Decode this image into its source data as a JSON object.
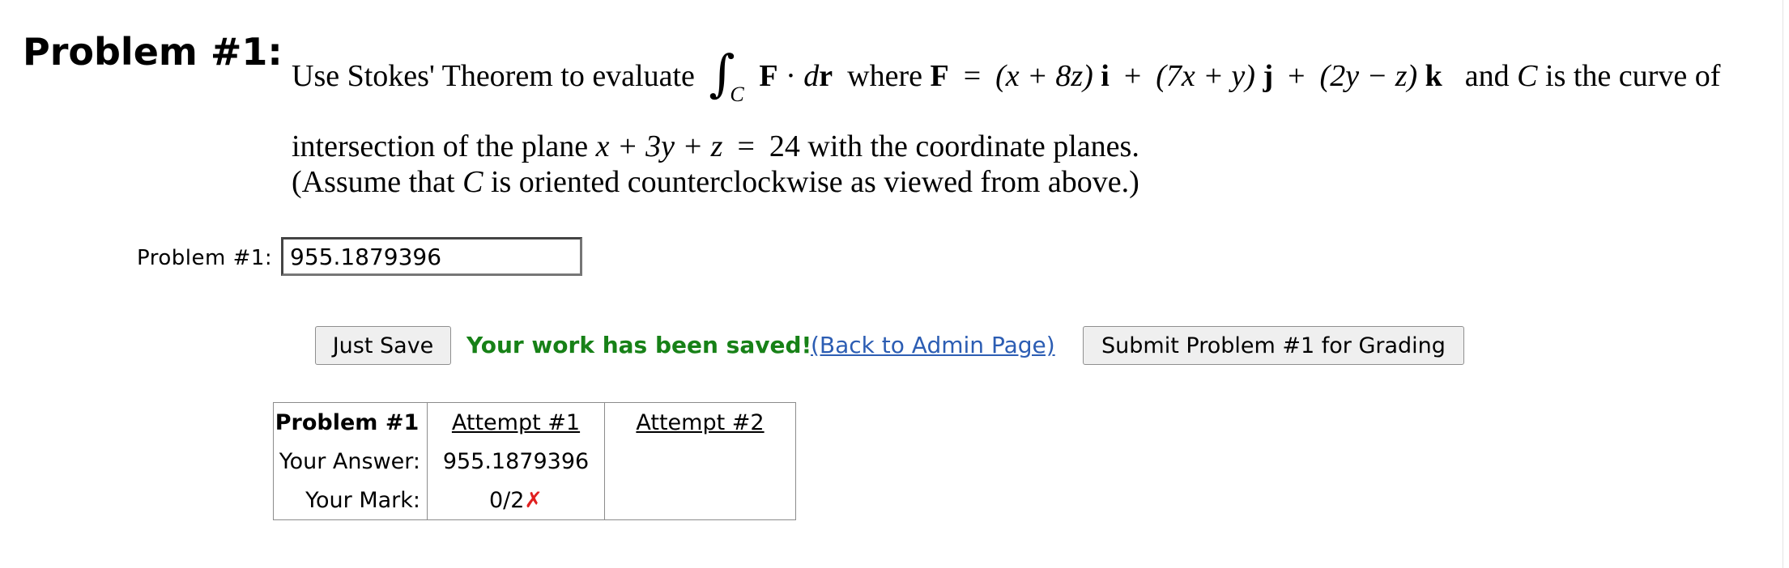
{
  "problem": {
    "heading": "Problem #1:",
    "statement": {
      "lead": "Use Stokes' Theorem to evaluate",
      "integral_sign": "∫",
      "integral_sub": "C",
      "integrand_F": "F",
      "integrand_dot": "·",
      "integrand_d": "d",
      "integrand_r": "r",
      "where": "where",
      "F": "F",
      "eq": "=",
      "comp_i_paren": "(x + 8z)",
      "i": "i",
      "plus1": "+",
      "comp_j_paren": "(7x + y)",
      "j": "j",
      "plus2": "+",
      "comp_k_paren": "(2y − z)",
      "k": "k",
      "and_text": "and",
      "C": "C",
      "tail": "is the curve of",
      "line2_lead": "intersection of the plane",
      "plane_eq": "x + 3y + z",
      "plane_eq_sign": "=",
      "plane_rhs": "24",
      "line2_tail": "with the coordinate planes.",
      "line3_lead": "(Assume that",
      "line3_C": "C",
      "line3_tail": "is oriented counterclockwise as viewed from above.)"
    }
  },
  "answer": {
    "label": "Problem #1:",
    "value": "955.1879396"
  },
  "actions": {
    "save_label": "Just Save",
    "saved_message": "Your work has been saved!",
    "admin_link": "(Back to Admin Page)",
    "submit_label": "Submit Problem #1 for Grading"
  },
  "attempts_table": {
    "header": [
      "Problem #1",
      "Attempt #1",
      "Attempt #2"
    ],
    "answer_label": "Your Answer:",
    "answer_values": [
      "955.1879396",
      ""
    ],
    "mark_label": "Your Mark:",
    "mark_values": [
      "0/2",
      ""
    ],
    "mark_icon": "✗"
  },
  "colors": {
    "success": "#178117",
    "link": "#2c5db3",
    "error_mark": "#e02020"
  }
}
